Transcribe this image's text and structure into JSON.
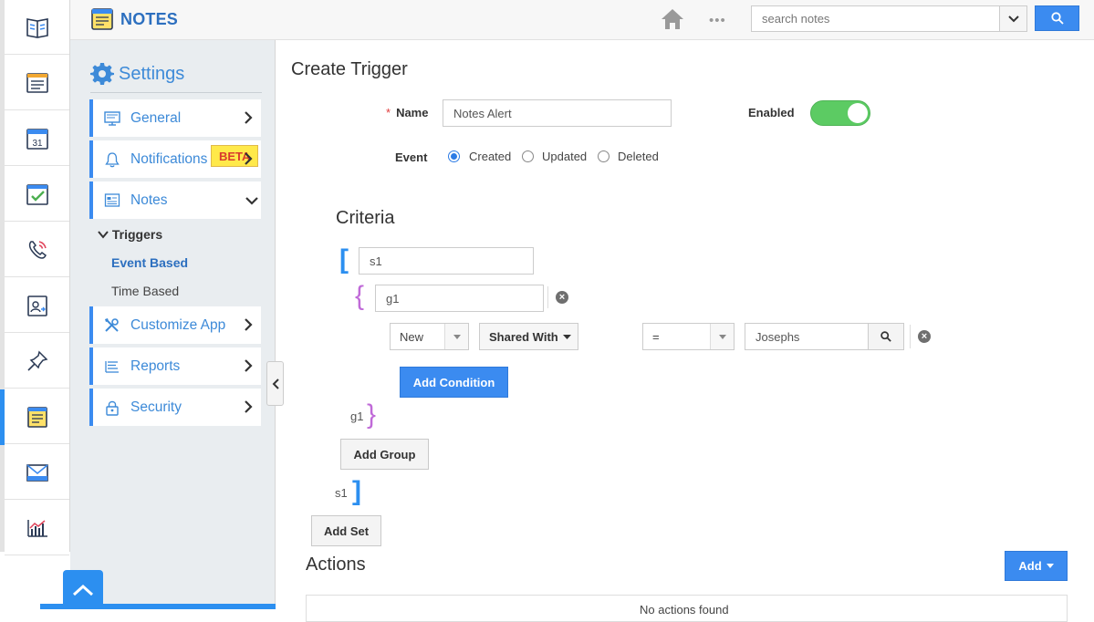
{
  "header": {
    "app_title": "NOTES",
    "search_placeholder": "search notes",
    "more_label": "•••"
  },
  "rail": {
    "items": [
      {
        "icon": "contacts-book-icon"
      },
      {
        "icon": "form-list-icon"
      },
      {
        "icon": "calendar-icon",
        "text": "31"
      },
      {
        "icon": "tasks-check-icon"
      },
      {
        "icon": "phone-call-icon"
      },
      {
        "icon": "contact-card-icon"
      },
      {
        "icon": "pin-icon"
      },
      {
        "icon": "notes-icon",
        "active": true
      },
      {
        "icon": "mail-icon"
      },
      {
        "icon": "reports-chart-icon"
      }
    ]
  },
  "settings": {
    "heading": "Settings",
    "menu": [
      {
        "label": "General",
        "icon": "monitor-icon"
      },
      {
        "label": "Notifications",
        "icon": "bell-icon",
        "badge": "BETA"
      },
      {
        "label": "Notes",
        "icon": "notes-list-icon",
        "expanded": true
      },
      {
        "label": "Customize App",
        "icon": "tools-icon"
      },
      {
        "label": "Reports",
        "icon": "list-icon"
      },
      {
        "label": "Security",
        "icon": "lock-icon"
      }
    ],
    "submenu": {
      "group_label": "Triggers",
      "items": [
        {
          "label": "Event Based",
          "active": true
        },
        {
          "label": "Time Based",
          "active": false
        }
      ]
    }
  },
  "form": {
    "title": "Create Trigger",
    "name_label": "Name",
    "name_value": "Notes Alert",
    "enabled_label": "Enabled",
    "enabled": true,
    "event_label": "Event",
    "event_options": [
      "Created",
      "Updated",
      "Deleted"
    ],
    "event_selected": "Created"
  },
  "criteria": {
    "heading": "Criteria",
    "set_value": "s1",
    "group_value": "g1",
    "condition": {
      "field1": "New",
      "field2": "Shared With",
      "operator": "=",
      "value": "Josephs"
    },
    "add_condition": "Add Condition",
    "group_end_label": "g1",
    "add_group": "Add Group",
    "set_end_label": "s1",
    "add_set": "Add Set"
  },
  "actions": {
    "heading": "Actions",
    "add_button": "Add",
    "empty_text": "No actions found"
  },
  "colors": {
    "accent": "#3b8bf0",
    "toggle_on": "#5ccb63",
    "beta_bg": "#ffe94a",
    "set_bracket": "#2c8ff0",
    "group_bracket": "#c06ad8"
  }
}
